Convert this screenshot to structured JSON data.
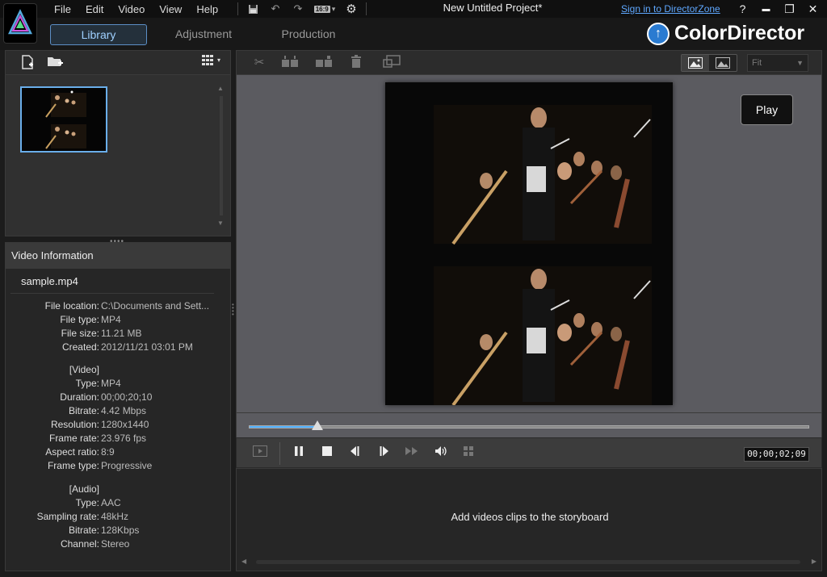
{
  "menu": [
    "File",
    "Edit",
    "Video",
    "View",
    "Help"
  ],
  "quick_access": {
    "ratio_label": "16:9",
    "ratio_caret": "▾"
  },
  "project_title": "New Untitled Project*",
  "signin_label": "Sign in to DirectorZone",
  "window_buttons": {
    "help": "?",
    "minimize": "▬",
    "maximize": "❐",
    "close": "✕"
  },
  "tabs": [
    "Library",
    "Adjustment",
    "Production"
  ],
  "brand": {
    "arrow": "↑",
    "name": "ColorDirector"
  },
  "library": {
    "view_caret": "▾"
  },
  "video_information": {
    "header": "Video Information",
    "file_name": "sample.mp4",
    "rows": [
      {
        "k": "File location:",
        "v": "C:\\Documents and Sett..."
      },
      {
        "k": "File type:",
        "v": "MP4"
      },
      {
        "k": "File size:",
        "v": "11.21 MB"
      },
      {
        "k": "Created:",
        "v": "2012/11/21 03:01 PM"
      },
      {
        "k": "[Video]",
        "v": ""
      },
      {
        "k": "Type:",
        "v": "MP4"
      },
      {
        "k": "Duration:",
        "v": "00;00;20;10"
      },
      {
        "k": "Bitrate:",
        "v": "4.42 Mbps"
      },
      {
        "k": "Resolution:",
        "v": "1280x1440"
      },
      {
        "k": "Frame rate:",
        "v": "23.976 fps"
      },
      {
        "k": "Aspect ratio:",
        "v": "8:9"
      },
      {
        "k": "Frame type:",
        "v": "Progressive"
      },
      {
        "k": "[Audio]",
        "v": ""
      },
      {
        "k": "Type:",
        "v": "AAC"
      },
      {
        "k": "Sampling rate:",
        "v": "48kHz"
      },
      {
        "k": "Bitrate:",
        "v": "128Kbps"
      },
      {
        "k": "Channel:",
        "v": "Stereo"
      }
    ]
  },
  "preview": {
    "fit_label": "Fit",
    "play_label": "Play",
    "progress_fraction": 0.123,
    "timecode": "00;00;02;09"
  },
  "storyboard": {
    "message": "Add videos clips to the storyboard"
  },
  "colors": {
    "accent": "#4fb0ff",
    "link": "#5fa8ff",
    "tab_border": "#5c8fc6"
  },
  "icons": {
    "toolbar_left": [
      "import-media-icon",
      "import-folder-icon",
      "grid-view-icon"
    ],
    "toolbar_right": [
      "cut-icon",
      "split-icon",
      "split-2-icon",
      "delete-icon",
      "fit-screen-icon"
    ],
    "controls": [
      "preview-icon",
      "pause-icon",
      "stop-icon",
      "prev-frame-icon",
      "next-frame-icon",
      "fast-forward-icon",
      "volume-icon",
      "snapshot-icon"
    ]
  }
}
